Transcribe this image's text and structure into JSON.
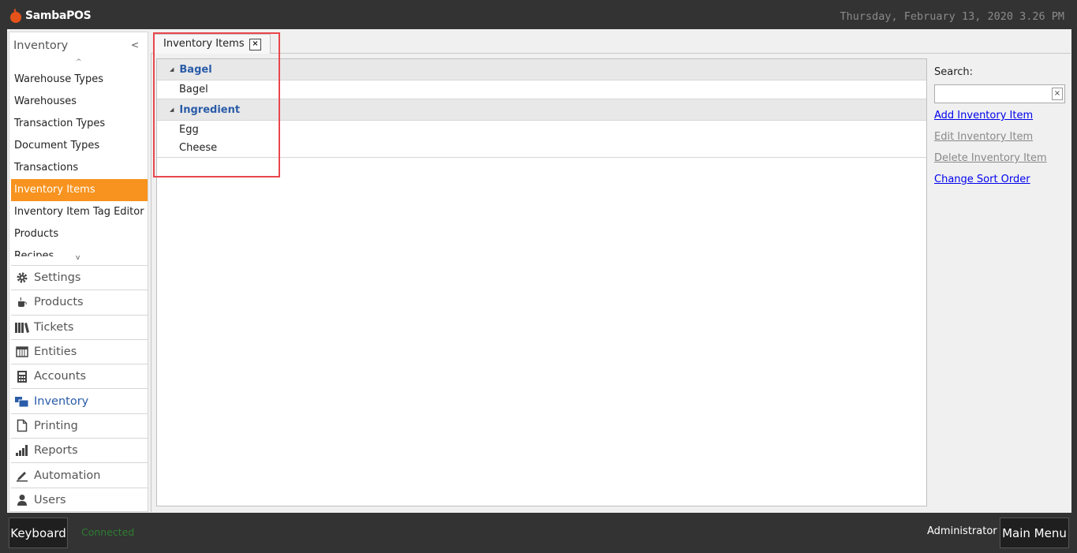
{
  "app": {
    "title": "SambaPOS",
    "datetime": "Thursday, February 13, 2020 3.26 PM"
  },
  "sidebar": {
    "title": "Inventory",
    "collapse": "<",
    "scroll_up": "^",
    "scroll_down": "v",
    "items": [
      {
        "label": "Warehouse Types"
      },
      {
        "label": "Warehouses"
      },
      {
        "label": "Transaction Types"
      },
      {
        "label": "Document Types"
      },
      {
        "label": "Transactions"
      },
      {
        "label": "Inventory Items"
      },
      {
        "label": "Inventory Item Tag Editor"
      },
      {
        "label": "Products"
      },
      {
        "label": "Recipes"
      }
    ],
    "active_item": "Inventory Items",
    "nav": [
      {
        "label": "Settings",
        "icon": "gear-icon"
      },
      {
        "label": "Products",
        "icon": "coffee-icon"
      },
      {
        "label": "Tickets",
        "icon": "books-icon"
      },
      {
        "label": "Entities",
        "icon": "table-icon"
      },
      {
        "label": "Accounts",
        "icon": "calculator-icon"
      },
      {
        "label": "Inventory",
        "icon": "inventory-icon"
      },
      {
        "label": "Printing",
        "icon": "document-icon"
      },
      {
        "label": "Reports",
        "icon": "bar-chart-icon"
      },
      {
        "label": "Automation",
        "icon": "pen-icon"
      },
      {
        "label": "Users",
        "icon": "user-icon"
      }
    ],
    "active_nav": "Inventory"
  },
  "tab": {
    "label": "Inventory Items",
    "close": "×"
  },
  "tree": {
    "groups": [
      {
        "name": "Bagel",
        "items": [
          "Bagel"
        ]
      },
      {
        "name": "Ingredient",
        "items": [
          "Egg",
          "Cheese"
        ]
      }
    ]
  },
  "side": {
    "search_label": "Search:",
    "search_value": "",
    "clear": "×",
    "links": [
      {
        "label": "Add Inventory Item",
        "enabled": true
      },
      {
        "label": "Edit Inventory Item",
        "enabled": false
      },
      {
        "label": "Delete Inventory Item",
        "enabled": false
      },
      {
        "label": "Change Sort Order",
        "enabled": true
      }
    ]
  },
  "footer": {
    "keyboard": "Keyboard",
    "status": "Connected",
    "user": "Administrator",
    "main_menu": "Main Menu"
  },
  "colors": {
    "accent": "#f7931e",
    "highlight": "#e8474c",
    "group_text": "#2a5ca8",
    "status": "#2e7d32"
  }
}
